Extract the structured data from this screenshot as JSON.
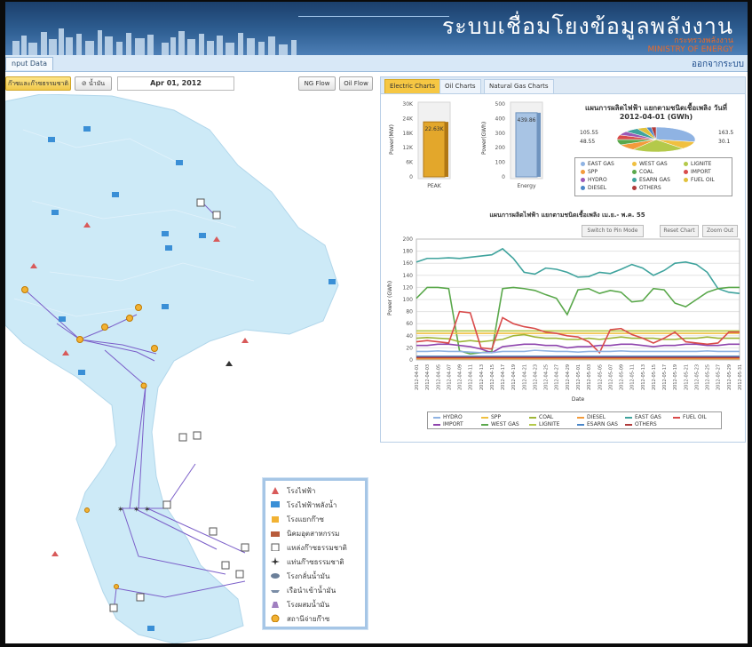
{
  "header": {
    "title": "ระบบเชื่อมโยงข้อมูลพลังงาน",
    "ministry_th": "กระทรวงพลังงาน",
    "ministry_en": "MINISTRY OF ENERGY"
  },
  "nav": {
    "tab_label": "nput Data",
    "logout_label": "ออกจากระบบ"
  },
  "map_controls": {
    "gas_button": "ก๊าซและก๊าซธรรมชาติ",
    "oil_button": "⊘ น้ำมัน",
    "date": "Apr 01, 2012",
    "ng_flow": "NG Flow",
    "oil_flow": "Oil Flow"
  },
  "legend": {
    "items": [
      {
        "label": "โรงไฟฟ้า",
        "icon": "power-plant-icon"
      },
      {
        "label": "โรงไฟฟ้าพลังน้ำ",
        "icon": "hydro-plant-icon"
      },
      {
        "label": "โรงแยกก๊าซ",
        "icon": "gas-separation-icon"
      },
      {
        "label": "นิคมอุตสาหกรรม",
        "icon": "industrial-estate-icon"
      },
      {
        "label": "แหล่งก๊าซธรรมชาติ",
        "icon": "gas-field-icon"
      },
      {
        "label": "แท่นก๊าซธรรมชาติ",
        "icon": "gas-platform-icon"
      },
      {
        "label": "โรงกลั่นน้ำมัน",
        "icon": "refinery-icon"
      },
      {
        "label": "เรือนำเข้าน้ำมัน",
        "icon": "oil-ship-icon"
      },
      {
        "label": "โรงผสมน้ำมัน",
        "icon": "oil-blending-icon"
      },
      {
        "label": "สถานีจ่ายก๊าซ",
        "icon": "gas-station-icon"
      }
    ]
  },
  "chart_tabs": [
    "Electric Charts",
    "Oil Charts",
    "Natural Gas Charts"
  ],
  "charts": {
    "peak": {
      "label": "PEAK",
      "value_label": "22.63K",
      "ylabel": "Power(MW)",
      "ticks": [
        "30K",
        "24K",
        "18K",
        "12K",
        "6K",
        "0"
      ],
      "value": 22630,
      "max": 30000
    },
    "energy": {
      "label": "Energy",
      "value_label": "439.86",
      "ylabel": "Power(GWh)",
      "ticks": [
        "500",
        "400",
        "300",
        "200",
        "100",
        "0"
      ],
      "value": 439.86,
      "max": 500
    },
    "pie": {
      "title_line1": "แผนการผลิตไฟฟ้า แยกตามชนิดเชื้อเพลิง วันที่",
      "title_line2": "2012-04-01  (GWh)",
      "labels": [
        "105.55",
        "48.55",
        "163.5",
        "30.1"
      ],
      "legend": [
        {
          "name": "EAST GAS",
          "color": "#8fb3e3"
        },
        {
          "name": "WEST GAS",
          "color": "#f0c040"
        },
        {
          "name": "LIGNITE",
          "color": "#b4c94a"
        },
        {
          "name": "SPP",
          "color": "#f39b3b"
        },
        {
          "name": "COAL",
          "color": "#5aa84b"
        },
        {
          "name": "IMPORT",
          "color": "#d94b4b"
        },
        {
          "name": "HYDRO",
          "color": "#9b59b6"
        },
        {
          "name": "ESARN GAS",
          "color": "#3fa39d"
        },
        {
          "name": "FUEL OIL",
          "color": "#e1c13b"
        },
        {
          "name": "DIESEL",
          "color": "#4a86c8"
        },
        {
          "name": "OTHERS",
          "color": "#b03a3a"
        }
      ]
    },
    "line": {
      "title": "แผนการผลิตไฟฟ้า แยกตามชนิดเชื้อเพลิง เม.ย.- พ.ค. 55",
      "buttons": [
        "Switch to Pin Mode",
        "Reset Chart",
        "Zoom Out"
      ],
      "ylabel": "Power (GWh)",
      "xlabel": "Date"
    }
  },
  "chart_data": {
    "type": "line",
    "title": "แผนการผลิตไฟฟ้า แยกตามชนิดเชื้อเพลิง เม.ย.- พ.ค. 55",
    "xlabel": "Date",
    "ylabel": "Power (GWh)",
    "ylim": [
      0,
      200
    ],
    "yticks": [
      0,
      20,
      40,
      60,
      80,
      100,
      120,
      140,
      160,
      180,
      200
    ],
    "x": [
      "2012-04-01",
      "2012-04-03",
      "2012-04-05",
      "2012-04-07",
      "2012-04-09",
      "2012-04-11",
      "2012-04-13",
      "2012-04-15",
      "2012-04-17",
      "2012-04-19",
      "2012-04-21",
      "2012-04-23",
      "2012-04-25",
      "2012-04-27",
      "2012-04-29",
      "2012-05-01",
      "2012-05-03",
      "2012-05-05",
      "2012-05-07",
      "2012-05-09",
      "2012-05-11",
      "2012-05-13",
      "2012-05-15",
      "2012-05-17",
      "2012-05-19",
      "2012-05-21",
      "2012-05-23",
      "2012-05-25",
      "2012-05-27",
      "2012-05-29",
      "2012-05-31"
    ],
    "series": [
      {
        "name": "EAST GAS",
        "color": "#3fa39d",
        "values": [
          162,
          168,
          168,
          169,
          168,
          170,
          172,
          174,
          184,
          168,
          145,
          142,
          152,
          150,
          145,
          137,
          138,
          145,
          143,
          150,
          158,
          152,
          140,
          148,
          160,
          162,
          158,
          145,
          118,
          112,
          110
        ]
      },
      {
        "name": "WEST GAS",
        "color": "#5aa84b",
        "values": [
          102,
          120,
          120,
          118,
          15,
          10,
          12,
          14,
          118,
          120,
          118,
          115,
          108,
          102,
          75,
          116,
          118,
          110,
          115,
          112,
          96,
          98,
          118,
          116,
          94,
          88,
          100,
          112,
          118,
          120,
          120
        ]
      },
      {
        "name": "LIGNITE",
        "color": "#b4c94a",
        "values": [
          48,
          48,
          48,
          48,
          48,
          48,
          48,
          48,
          48,
          48,
          48,
          48,
          48,
          48,
          48,
          48,
          48,
          48,
          48,
          48,
          48,
          48,
          48,
          48,
          48,
          48,
          48,
          48,
          48,
          48,
          48
        ]
      },
      {
        "name": "SPP",
        "color": "#f0c040",
        "values": [
          44,
          44,
          44,
          44,
          44,
          44,
          44,
          44,
          44,
          44,
          44,
          44,
          44,
          44,
          44,
          44,
          44,
          44,
          44,
          44,
          44,
          44,
          44,
          44,
          44,
          44,
          44,
          44,
          44,
          44,
          44
        ]
      },
      {
        "name": "COAL",
        "color": "#9fb637",
        "values": [
          36,
          37,
          36,
          35,
          30,
          32,
          30,
          32,
          34,
          40,
          42,
          38,
          36,
          36,
          34,
          34,
          36,
          34,
          36,
          38,
          36,
          36,
          36,
          34,
          34,
          36,
          36,
          38,
          36,
          36,
          36
        ]
      },
      {
        "name": "IMPORT",
        "color": "#8e44ad",
        "values": [
          24,
          24,
          26,
          26,
          24,
          22,
          18,
          12,
          22,
          24,
          26,
          26,
          24,
          24,
          20,
          22,
          22,
          24,
          24,
          26,
          26,
          24,
          22,
          24,
          24,
          26,
          26,
          24,
          24,
          26,
          26
        ]
      },
      {
        "name": "FUEL OIL",
        "color": "#d94b4b",
        "values": [
          30,
          32,
          30,
          28,
          80,
          78,
          20,
          18,
          70,
          60,
          55,
          52,
          46,
          44,
          40,
          38,
          30,
          12,
          50,
          52,
          42,
          36,
          28,
          36,
          46,
          30,
          28,
          26,
          28,
          46,
          46
        ]
      },
      {
        "name": "HYDRO",
        "color": "#8fb3e3",
        "values": [
          14,
          14,
          15,
          14,
          14,
          13,
          12,
          12,
          14,
          14,
          14,
          16,
          15,
          14,
          14,
          13,
          14,
          14,
          14,
          15,
          14,
          14,
          14,
          14,
          14,
          14,
          14,
          15,
          14,
          14,
          14
        ]
      },
      {
        "name": "ESARN GAS",
        "color": "#4a86c8",
        "values": [
          6,
          6,
          6,
          6,
          6,
          6,
          6,
          6,
          6,
          6,
          6,
          6,
          6,
          6,
          6,
          6,
          6,
          6,
          6,
          6,
          6,
          6,
          6,
          6,
          6,
          6,
          6,
          6,
          6,
          6,
          6
        ]
      },
      {
        "name": "DIESEL",
        "color": "#f39b3b",
        "values": [
          2,
          2,
          2,
          2,
          2,
          2,
          2,
          2,
          2,
          2,
          2,
          2,
          2,
          2,
          2,
          2,
          2,
          2,
          2,
          2,
          2,
          2,
          2,
          2,
          2,
          2,
          2,
          2,
          2,
          2,
          2
        ]
      },
      {
        "name": "OTHERS",
        "color": "#b03a3a",
        "values": [
          4,
          4,
          4,
          4,
          4,
          4,
          4,
          4,
          4,
          4,
          4,
          4,
          4,
          4,
          4,
          4,
          4,
          4,
          4,
          4,
          4,
          4,
          4,
          4,
          4,
          4,
          4,
          4,
          4,
          4,
          4
        ]
      }
    ],
    "legend": [
      "HYDRO",
      "SPP",
      "COAL",
      "DIESEL",
      "EAST GAS",
      "FUEL OIL",
      "IMPORT",
      "WEST GAS",
      "LIGNITE",
      "ESARN GAS",
      "OTHERS"
    ]
  }
}
